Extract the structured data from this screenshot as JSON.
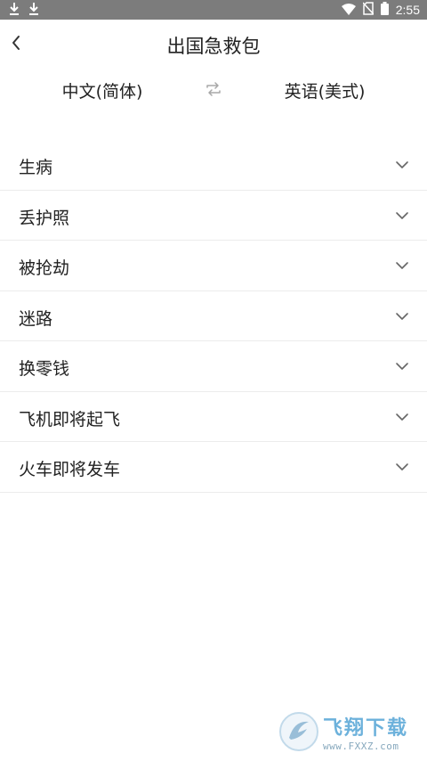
{
  "status_bar": {
    "time": "2:55",
    "left_icons": [
      "download-icon",
      "download-icon"
    ],
    "right_icons": [
      "wifi-icon",
      "no-sim-icon",
      "battery-icon"
    ]
  },
  "header": {
    "title": "出国急救包",
    "back_icon": "back-arrow-icon"
  },
  "languages": {
    "source": "中文(简体)",
    "target": "英语(美式)",
    "swap_icon": "swap-icon"
  },
  "categories": [
    {
      "label": "生病"
    },
    {
      "label": "丢护照"
    },
    {
      "label": "被抢劫"
    },
    {
      "label": "迷路"
    },
    {
      "label": "换零钱"
    },
    {
      "label": "飞机即将起飞"
    },
    {
      "label": "火车即将发车"
    }
  ],
  "watermark": {
    "brand": "飞翔下载",
    "url": "www.FXXZ.com"
  },
  "colors": {
    "status_bar": "#7c7c7c",
    "divider": "#ececec",
    "text": "#222222",
    "icon_gray": "#9a9a9a",
    "watermark_blue": "#5da9d8"
  }
}
